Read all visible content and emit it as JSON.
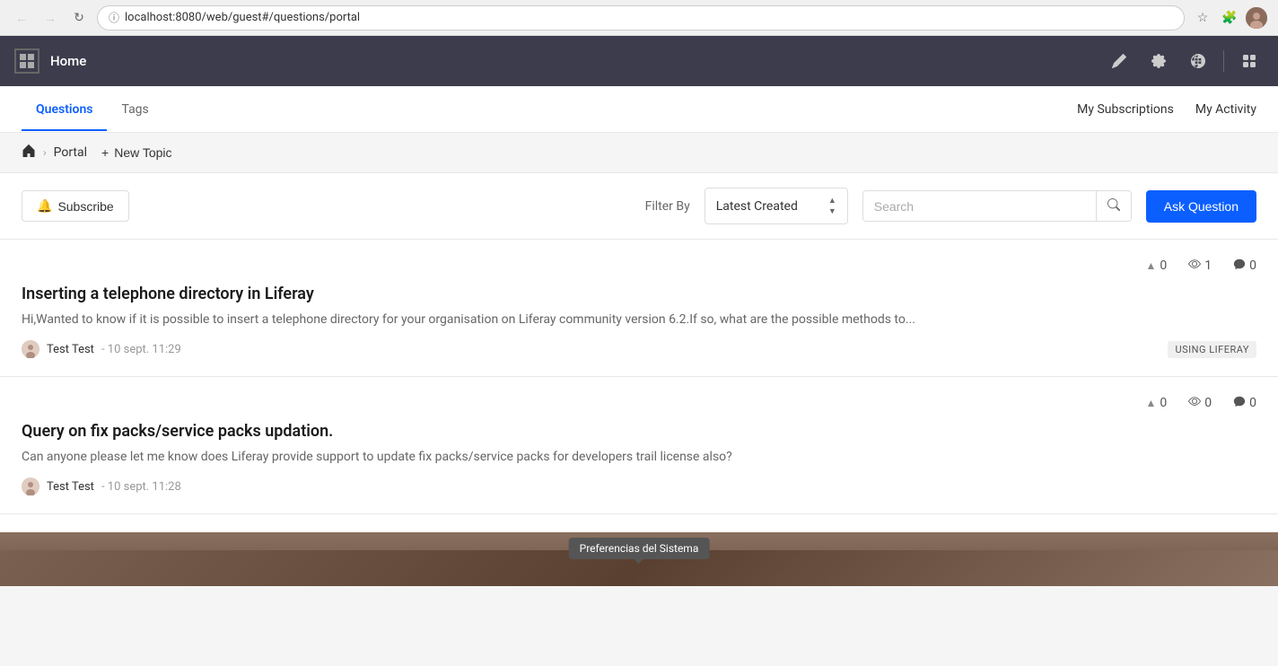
{
  "browser": {
    "url": "localhost:8080/web/guest#/questions/portal",
    "back_disabled": true,
    "forward_disabled": true
  },
  "navbar": {
    "home_label": "Home",
    "icons": [
      "edit-icon",
      "settings-icon",
      "globe-icon",
      "divider",
      "grid-icon"
    ]
  },
  "subnav": {
    "tabs": [
      {
        "label": "Questions",
        "active": true
      },
      {
        "label": "Tags",
        "active": false
      }
    ],
    "actions": [
      {
        "label": "My Subscriptions"
      },
      {
        "label": "My Activity"
      }
    ]
  },
  "breadcrumb": {
    "home_title": "Home",
    "items": [
      "Portal"
    ],
    "new_topic_label": "New Topic"
  },
  "filter_bar": {
    "subscribe_label": "Subscribe",
    "filter_by_label": "Filter By",
    "filter_selected": "Latest Created",
    "search_placeholder": "Search",
    "ask_question_label": "Ask Question"
  },
  "questions": [
    {
      "id": 1,
      "votes": 0,
      "views": 1,
      "comments": 0,
      "title": "Inserting a telephone directory in Liferay",
      "excerpt": "Hi,Wanted to know if it is possible to insert a telephone directory for your organisation on Liferay community version 6.2.If so, what are the possible methods to...",
      "author": "Test Test",
      "date": "10 sept. 11:29",
      "tag": "USING LIFERAY"
    },
    {
      "id": 2,
      "votes": 0,
      "views": 0,
      "comments": 0,
      "title": "Query on fix packs/service packs updation.",
      "excerpt": "Can anyone please let me know does Liferay provide support to update fix packs/service packs  for developers trail license also?",
      "author": "Test Test",
      "date": "10 sept. 11:28",
      "tag": null
    }
  ],
  "footer": {
    "tooltip_label": "Preferencias del Sistema"
  }
}
